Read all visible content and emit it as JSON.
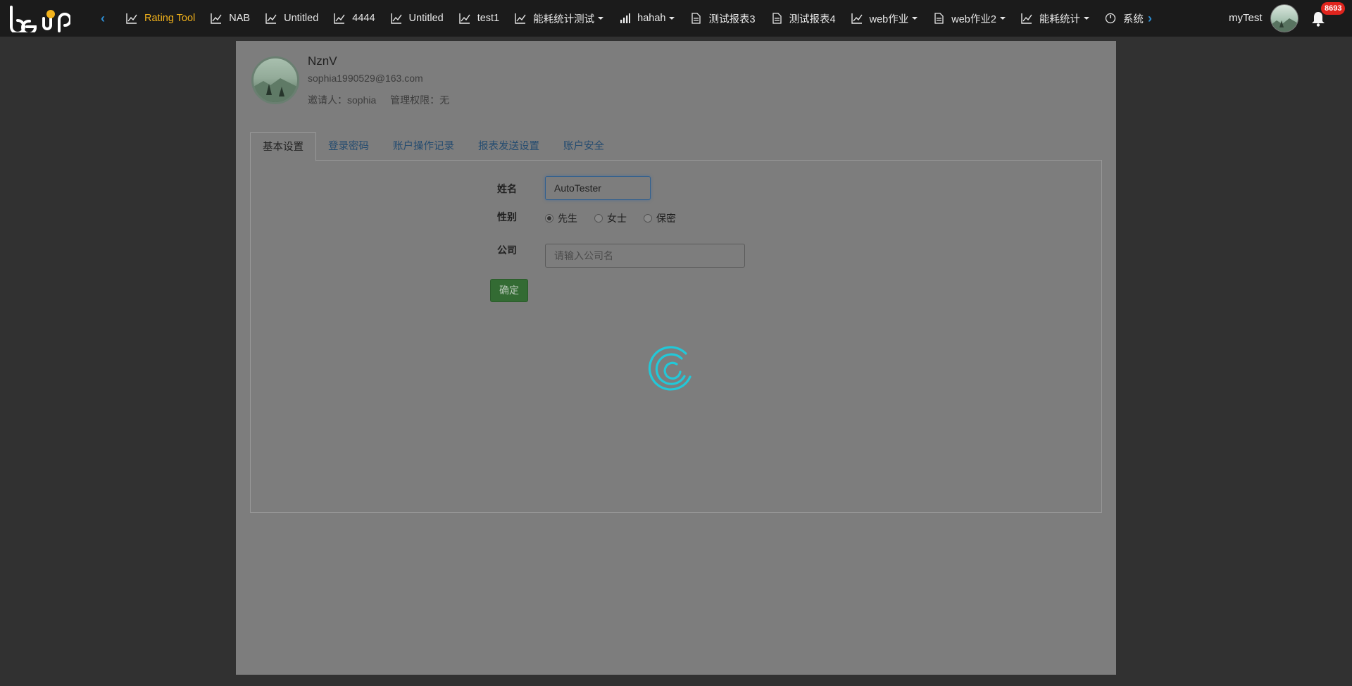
{
  "nav": {
    "tabs": [
      {
        "label": "Rating Tool",
        "icon": "line-chart-icon",
        "active": true,
        "dropdown": false
      },
      {
        "label": "NAB",
        "icon": "line-chart-icon",
        "active": false,
        "dropdown": false
      },
      {
        "label": "Untitled",
        "icon": "line-chart-icon",
        "active": false,
        "dropdown": false
      },
      {
        "label": "4444",
        "icon": "line-chart-icon",
        "active": false,
        "dropdown": false
      },
      {
        "label": "Untitled",
        "icon": "line-chart-icon",
        "active": false,
        "dropdown": false
      },
      {
        "label": "test1",
        "icon": "line-chart-icon",
        "active": false,
        "dropdown": false
      },
      {
        "label": "能耗统计测试",
        "icon": "line-chart-icon",
        "active": false,
        "dropdown": true
      },
      {
        "label": "hahah",
        "icon": "bar-signal-icon",
        "active": false,
        "dropdown": true
      },
      {
        "label": "测试报表3",
        "icon": "document-icon",
        "active": false,
        "dropdown": false
      },
      {
        "label": "测试报表4",
        "icon": "document-icon",
        "active": false,
        "dropdown": false
      },
      {
        "label": "web作业",
        "icon": "line-chart-icon",
        "active": false,
        "dropdown": true
      },
      {
        "label": "web作业2",
        "icon": "document-icon",
        "active": false,
        "dropdown": true
      },
      {
        "label": "能耗统计",
        "icon": "line-chart-icon",
        "active": false,
        "dropdown": true
      },
      {
        "label": "系统",
        "icon": "power-icon",
        "active": false,
        "dropdown": false
      }
    ],
    "user_name": "myTest",
    "notification_count": "8693",
    "accent_color": "#f2b21b",
    "arrow_color": "#2d8fd5"
  },
  "profile": {
    "name": "NznV",
    "email": "sophia1990529@163.com",
    "inviter": "邀请人：sophia",
    "permission": "管理权限：无"
  },
  "tabs": [
    {
      "label": "基本设置",
      "active": true
    },
    {
      "label": "登录密码",
      "active": false
    },
    {
      "label": "账户操作记录",
      "active": false
    },
    {
      "label": "报表发送设置",
      "active": false
    },
    {
      "label": "账户安全",
      "active": false
    }
  ],
  "form": {
    "name_label": "姓名",
    "name_value": "AutoTester",
    "gender_label": "性别",
    "gender_options": [
      "先生",
      "女士",
      "保密"
    ],
    "gender_selected": "先生",
    "company_label": "公司",
    "company_placeholder": "请输入公司名",
    "confirm_label": "确定"
  },
  "loading": {
    "spinner_color": "#22c8d8"
  }
}
